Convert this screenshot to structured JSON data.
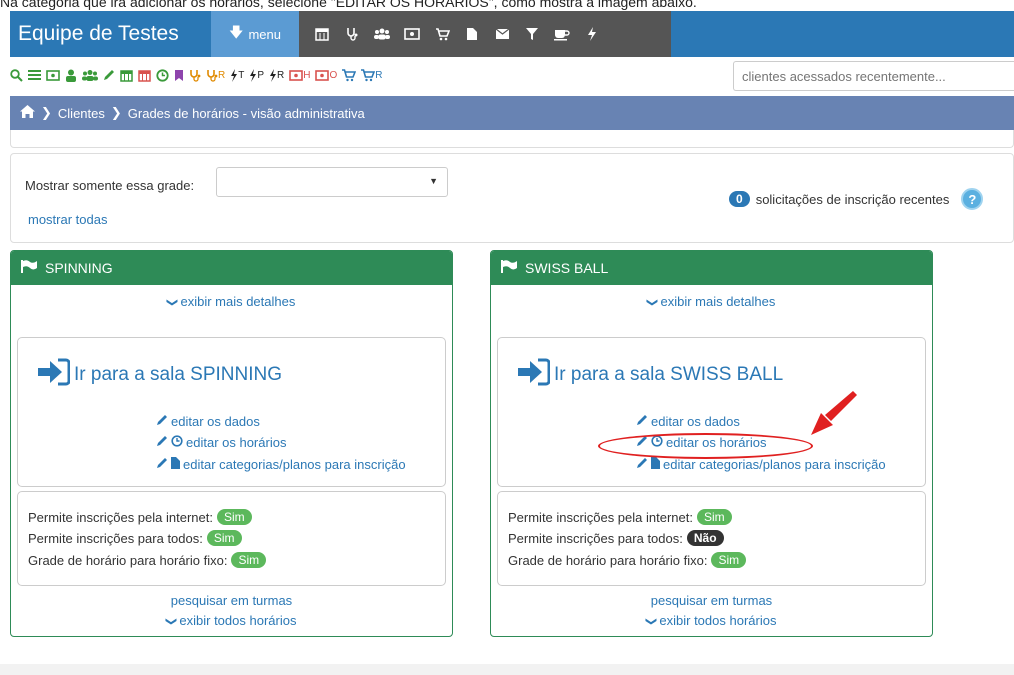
{
  "caption": "Na categoria que irá adicionar os horários, selecione \"EDITAR OS HORÁRIOS\", como mostra a imagem abaixo.",
  "topbar": {
    "brand": "Equipe de Testes",
    "menu_label": "menu",
    "tool_icons": [
      "calendar-icon",
      "stethoscope-icon",
      "group-icon",
      "money-icon",
      "cart-icon",
      "file-icon",
      "envelope-icon",
      "filter-icon",
      "coffee-icon",
      "bolt-icon"
    ]
  },
  "quickbar": {
    "items": [
      {
        "icon": "search-icon",
        "text": "",
        "color": "green"
      },
      {
        "icon": "list-icon",
        "text": "",
        "color": "green"
      },
      {
        "icon": "money-icon",
        "text": "",
        "color": "green"
      },
      {
        "icon": "user-icon",
        "text": "",
        "color": "green"
      },
      {
        "icon": "group-icon",
        "text": "",
        "color": "green"
      },
      {
        "icon": "pencil-icon",
        "text": "",
        "color": "green"
      },
      {
        "icon": "calendar-icon",
        "text": "",
        "color": "green"
      },
      {
        "icon": "calendar-red-icon",
        "text": "",
        "color": "red"
      },
      {
        "icon": "clock-icon",
        "text": "",
        "color": "green"
      },
      {
        "icon": "bookmark-icon",
        "text": "",
        "color": "purple"
      },
      {
        "icon": "stethoscope-icon",
        "text": "",
        "color": "orange"
      },
      {
        "icon": "stethoscope-r-icon",
        "text": "R",
        "color": "orange"
      },
      {
        "icon": "bolt-t-icon",
        "text": "T",
        "color": "dark"
      },
      {
        "icon": "bolt-p-icon",
        "text": "P",
        "color": "dark"
      },
      {
        "icon": "bolt-r-icon",
        "text": "R",
        "color": "dark"
      },
      {
        "icon": "money-h-icon",
        "text": "H",
        "color": "red"
      },
      {
        "icon": "money-o-icon",
        "text": "O",
        "color": "red"
      },
      {
        "icon": "cart-icon",
        "text": "",
        "color": "blue"
      },
      {
        "icon": "cart-r-icon",
        "text": "R",
        "color": "blue"
      }
    ],
    "recent_clients_placeholder": "clientes acessados recentemente..."
  },
  "breadcrumb": {
    "items": [
      "Clientes",
      "Grades de horários - visão administrativa"
    ]
  },
  "filter": {
    "label": "Mostrar somente essa grade:",
    "selected": "",
    "show_all": "mostrar todas",
    "request_count": "0",
    "request_text": "solicitações de inscrição recentes",
    "help": "?"
  },
  "panels": [
    {
      "title": "SPINNING",
      "more_details": "exibir mais detalhes",
      "go_room": "Ir para a sala SPINNING",
      "edit_data": "editar os dados",
      "edit_schedule": "editar os horários",
      "edit_categories": "editar categorias/planos para inscrição",
      "internet_label": "Permite inscrições pela internet:",
      "internet_value": "Sim",
      "all_label": "Permite inscrições para todos:",
      "all_value": "Sim",
      "fixed_label": "Grade de horário para horário fixo:",
      "fixed_value": "Sim",
      "search_classes": "pesquisar em turmas",
      "show_all_times": "exibir todos horários"
    },
    {
      "title": "SWISS BALL",
      "more_details": "exibir mais detalhes",
      "go_room": "Ir para a sala SWISS BALL",
      "edit_data": "editar os dados",
      "edit_schedule": "editar os horários",
      "edit_categories": "editar categorias/planos para inscrição",
      "internet_label": "Permite inscrições pela internet:",
      "internet_value": "Sim",
      "all_label": "Permite inscrições para todos:",
      "all_value": "Não",
      "fixed_label": "Grade de horário para horário fixo:",
      "fixed_value": "Sim",
      "search_classes": "pesquisar em turmas",
      "show_all_times": "exibir todos horários"
    }
  ],
  "colors": {
    "topbar": "#2b78b5",
    "panel_header": "#2e8b57",
    "breadcrumb": "#6883b3",
    "annotation": "#e02020"
  }
}
